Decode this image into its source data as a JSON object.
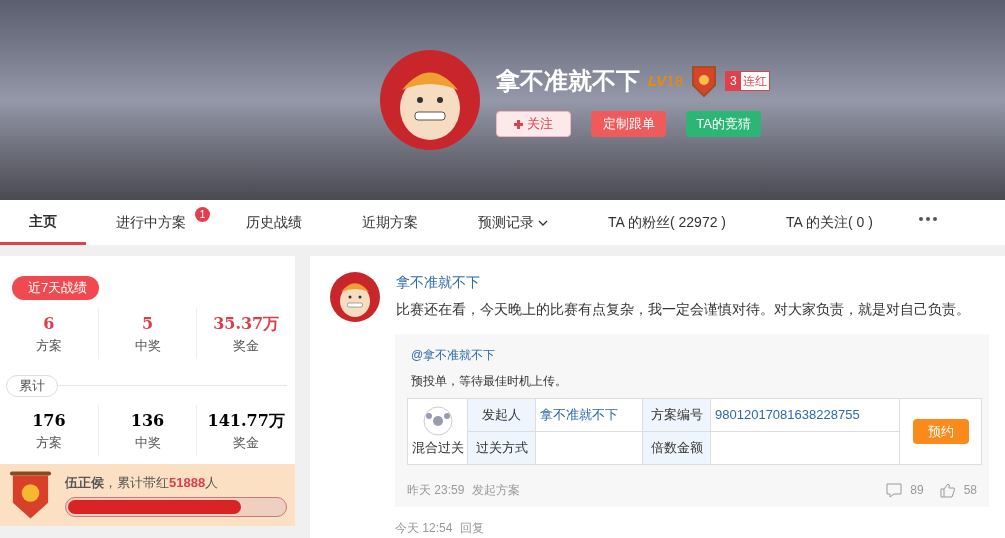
{
  "profile": {
    "name": "拿不准就不下",
    "level_prefix": "LV",
    "level": "18",
    "streak_count": "3",
    "streak_label": "连红",
    "buttons": [
      {
        "kind": "follow",
        "label": "关注"
      },
      {
        "kind": "custom",
        "label": "定制跟单"
      },
      {
        "kind": "guess",
        "label": "TA的竞猜"
      }
    ]
  },
  "tabs": [
    {
      "label": "主页",
      "selected": true
    },
    {
      "label": "进行中方案",
      "selected": false,
      "badge": "1"
    },
    {
      "label": "历史战绩",
      "selected": false
    },
    {
      "label": "近期方案",
      "selected": false
    },
    {
      "label": "预测记录",
      "selected": false,
      "dropdown": true
    },
    {
      "label": "TA 的粉丝( 22972 )",
      "selected": false
    },
    {
      "label": "TA 的关注( 0 )",
      "selected": false
    }
  ],
  "stats": {
    "recent_title": "近7天战绩",
    "recent": [
      {
        "value": "6",
        "label": "方案"
      },
      {
        "value": "5",
        "label": "中奖"
      },
      {
        "value": "35.37万",
        "label": "奖金"
      }
    ],
    "total_title": "累计",
    "total": [
      {
        "value": "176",
        "label": "方案"
      },
      {
        "value": "136",
        "label": "中奖"
      },
      {
        "value": "141.77万",
        "label": "奖金"
      }
    ],
    "rank_title": "伍正侯",
    "rank_text": "，累计带红",
    "rank_count": "51888",
    "rank_unit": "人",
    "level": 0.8
  },
  "post": {
    "author": "拿不准就不下",
    "text": "比赛还在看，今天晚上的比赛有点复杂，我一定会谨慎对待。对大家负责，就是对自己负责。",
    "quote": {
      "mention": "@拿不准就不下",
      "text": "预投单，等待最佳时机上传。",
      "type_label": "混合过关",
      "rows": [
        [
          {
            "label": "发起人",
            "value": "拿不准就不下"
          },
          {
            "label": "方案编号",
            "value": "98012017081638228755"
          }
        ],
        [
          {
            "label": "过关方式"
          },
          {
            "label": "倍数金额"
          }
        ]
      ],
      "button": "预约",
      "time": "昨天 23:59",
      "action": "发起方案",
      "comments": "89",
      "likes": "58"
    }
  },
  "next": {
    "time": "今天 12:54",
    "action": "回复"
  }
}
